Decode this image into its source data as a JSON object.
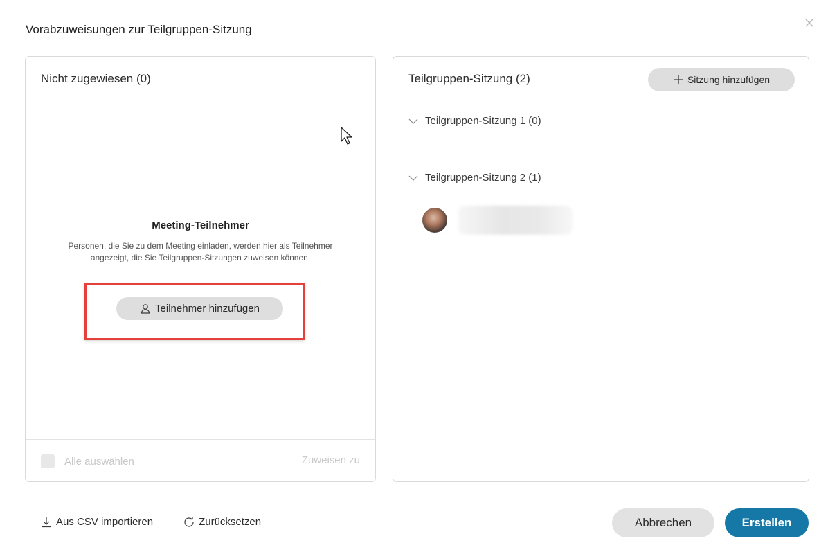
{
  "dialog": {
    "title": "Vorabzuweisungen zur Teilgruppen-Sitzung",
    "close_icon": "close-icon"
  },
  "unassigned": {
    "title": "Nicht zugewiesen (0)",
    "empty_title": "Meeting-Teilnehmer",
    "empty_description": "Personen, die Sie zu dem Meeting einladen, werden hier als Teilnehmer angezeigt, die Sie Teilgruppen-Sitzungen zuweisen können.",
    "add_participant_label": "Teilnehmer hinzufügen",
    "add_participant_icon": "person-icon",
    "select_all_label": "Alle auswählen",
    "assign_to_label": "Zuweisen zu",
    "highlight_color": "#e3413a"
  },
  "sessions": {
    "title": "Teilgruppen-Sitzung (2)",
    "add_session_label": "Sitzung hinzufügen",
    "add_session_icon": "plus-icon",
    "items": [
      {
        "label": "Teilgruppen-Sitzung 1 (0)",
        "icon": "chevron-down-icon"
      },
      {
        "label": "Teilgruppen-Sitzung 2 (1)",
        "icon": "chevron-down-icon"
      }
    ]
  },
  "footer": {
    "import_csv_label": "Aus CSV importieren",
    "import_icon": "download-icon",
    "reset_label": "Zurücksetzen",
    "reset_icon": "refresh-icon",
    "cancel_label": "Abbrechen",
    "create_label": "Erstellen",
    "primary_color": "#1578a6"
  }
}
